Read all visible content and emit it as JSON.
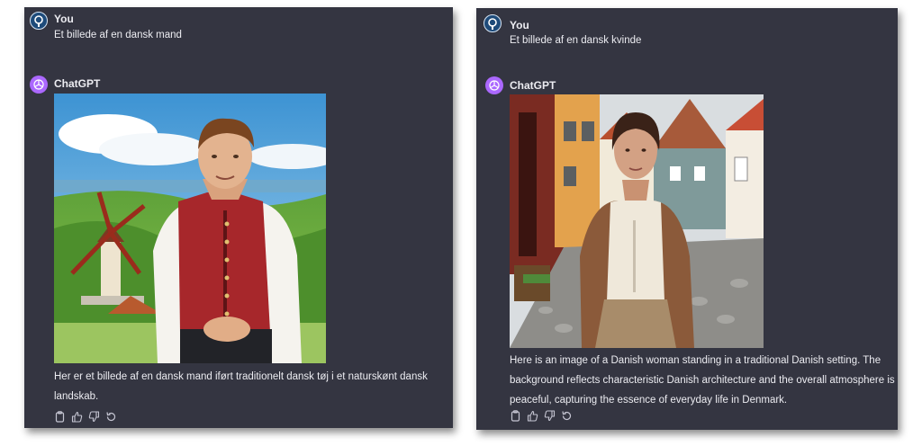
{
  "left": {
    "user_name": "You",
    "user_prompt": "Et billede af en dansk mand",
    "assistant_name": "ChatGPT",
    "reply_text": "Her er et billede af en dansk mand iført traditionelt dansk tøj i et naturskønt dansk landskab."
  },
  "right": {
    "user_name": "You",
    "user_prompt": "Et billede af en dansk kvinde",
    "assistant_name": "ChatGPT",
    "reply_text": "Here is an image of a Danish woman standing in a traditional Danish setting. The background reflects characteristic Danish architecture and the overall atmosphere is peaceful, capturing the essence of everyday life in Denmark."
  },
  "icons": {
    "actions": [
      "copy-icon",
      "thumbs-up-icon",
      "thumbs-down-icon",
      "regenerate-icon"
    ]
  },
  "colors": {
    "panel_bg": "#343541",
    "text": "#ececf1",
    "gpt_avatar": "#ab68ff",
    "user_avatar": "#1e4b7a"
  }
}
